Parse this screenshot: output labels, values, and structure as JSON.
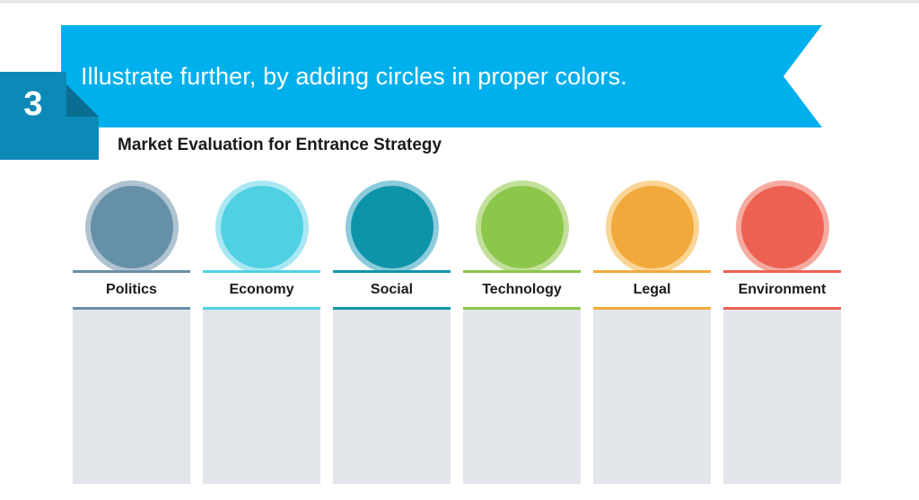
{
  "slide": {
    "instruction": "Illustrate further, by adding circles in proper colors.",
    "step_number": "3",
    "subtitle": "Market Evaluation for Entrance Strategy"
  },
  "theme": {
    "ribbon_color": "#00B0EC",
    "badge_color": "#0D89B8",
    "badge_fold_color": "#0A6E93",
    "panel_color": "#E2E5EA",
    "top_strip_color": "#E9E9E9",
    "text_dark": "#1A1A1A",
    "text_light": "#FFFFFF"
  },
  "columns": [
    {
      "label": "Politics",
      "circle_color": "#6690A8",
      "halo_color": "#AFC3D0",
      "rule_color": "#6690A8",
      "panel_color": "#E2E5EA"
    },
    {
      "label": "Economy",
      "circle_color": "#4FD1E3",
      "halo_color": "#A9E8F2",
      "rule_color": "#4FD1E3",
      "panel_color": "#E2E5EA"
    },
    {
      "label": "Social",
      "circle_color": "#0E94A8",
      "halo_color": "#8CCBDC",
      "rule_color": "#0E94A8",
      "panel_color": "#E2E5EA"
    },
    {
      "label": "Technology",
      "circle_color": "#8CC64A",
      "halo_color": "#C2E09A",
      "rule_color": "#8CC64A",
      "panel_color": "#E2E5EA"
    },
    {
      "label": "Legal",
      "circle_color": "#F2A93B",
      "halo_color": "#F9D596",
      "rule_color": "#F2A93B",
      "panel_color": "#E2E5EA"
    },
    {
      "label": "Environment",
      "circle_color": "#EE6152",
      "halo_color": "#F6ABA1",
      "rule_color": "#EE6152",
      "panel_color": "#E2E5EA"
    }
  ]
}
